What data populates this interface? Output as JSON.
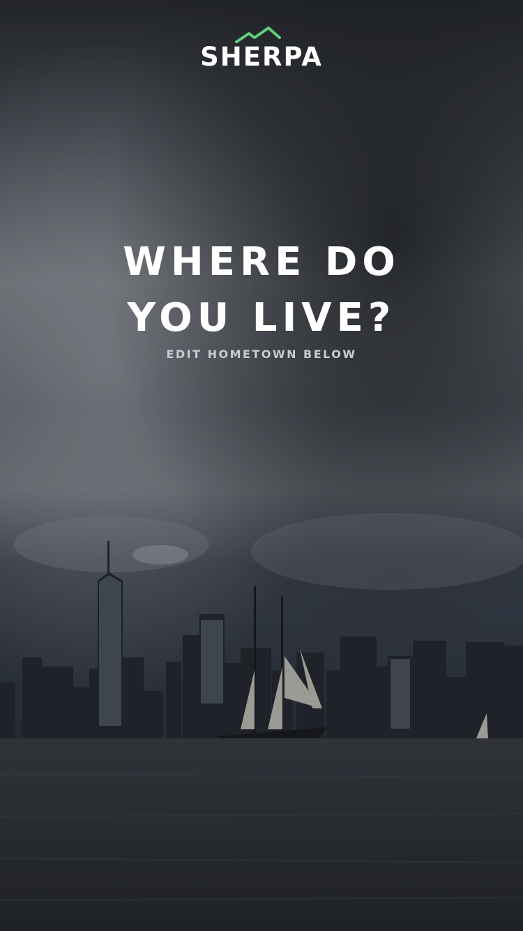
{
  "brand": {
    "name": "SHERPA",
    "accent_color": "#5fd07a"
  },
  "prompt": {
    "line1": "WHERE DO",
    "line2": "YOU LIVE?",
    "subtitle": "EDIT HOMETOWN BELOW"
  },
  "background": {
    "description_icon": "city-skyline-photo",
    "sky_color": "#3a3f48",
    "water_color": "#30343b"
  }
}
